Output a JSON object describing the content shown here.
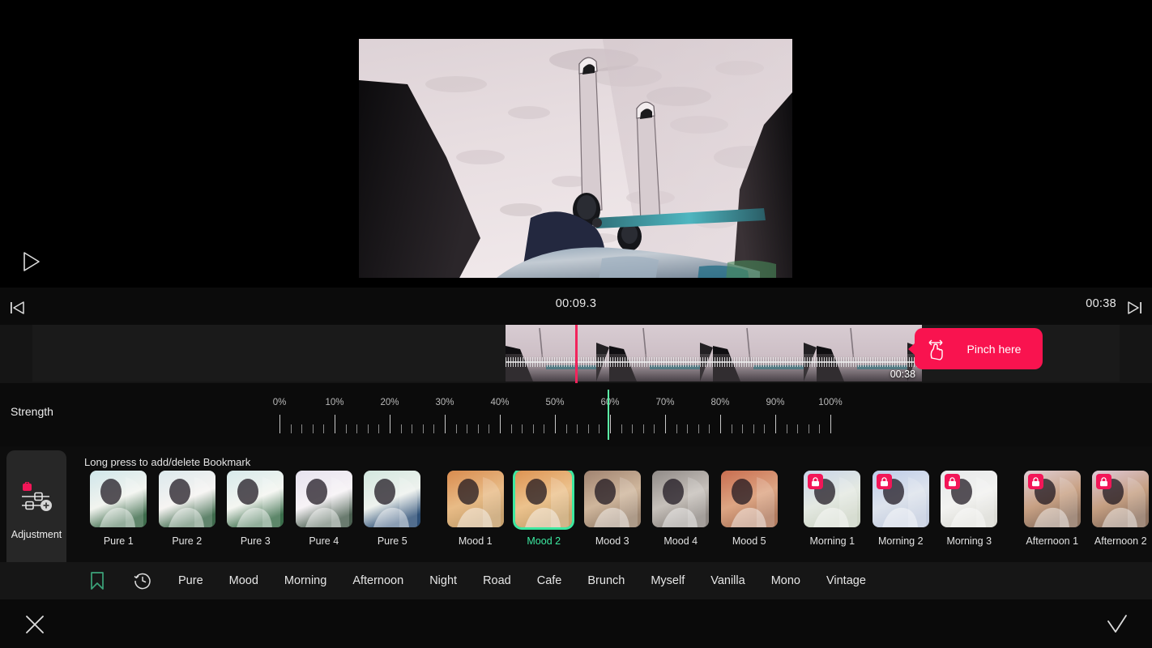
{
  "preview": {
    "play_icon": "play-icon",
    "video_description": "POV skiing down snowy slope"
  },
  "timebar": {
    "current_time": "00:09.3",
    "total_time": "00:38",
    "jump_start_icon": "skip-to-start-icon",
    "jump_end_icon": "skip-to-end-icon",
    "prev_frame_icon": "previous-frame-icon",
    "next_frame_icon": "next-frame-icon"
  },
  "timeline": {
    "clip_duration_label": "00:38",
    "tooltip": {
      "label": "Pinch here",
      "icon": "pinch-gesture-icon",
      "color": "#f9134f"
    },
    "playhead_color": "#f2245c"
  },
  "strength": {
    "label": "Strength",
    "value": 60,
    "unit": "%",
    "ticks": [
      "0%",
      "10%",
      "20%",
      "30%",
      "40%",
      "50%",
      "60%",
      "70%",
      "80%",
      "90%",
      "100%"
    ],
    "indicator_color": "#5bf0a5"
  },
  "adjustment": {
    "label": "Adjustment",
    "icon": "sliders-icon",
    "locked": true,
    "lock_color": "#f31658"
  },
  "filters": {
    "hint": "Long press to add/delete Bookmark",
    "selected": "Mood 2",
    "selected_color": "#3ce8a0",
    "groups": [
      {
        "name": "Pure",
        "items": [
          {
            "label": "Pure 1",
            "locked": false,
            "t1": "#cfe6ea",
            "t2": "#f2f4ef",
            "t3": "#3d6b4b"
          },
          {
            "label": "Pure 2",
            "locked": false,
            "t1": "#dbe8ec",
            "t2": "#f6f4f2",
            "t3": "#3e6a4c"
          },
          {
            "label": "Pure 3",
            "locked": false,
            "t1": "#d6e9ea",
            "t2": "#f4f6f1",
            "t3": "#3a6d4a"
          },
          {
            "label": "Pure 4",
            "locked": false,
            "t1": "#e6e2ee",
            "t2": "#f7f3f6",
            "t3": "#4a5f50"
          },
          {
            "label": "Pure 5",
            "locked": false,
            "t1": "#d2e7de",
            "t2": "#eef2ee",
            "t3": "#2d4f76"
          }
        ]
      },
      {
        "name": "Mood",
        "items": [
          {
            "label": "Mood 1",
            "locked": false,
            "t1": "#d98b4e",
            "t2": "#e8bb86",
            "t3": "#c6a06d"
          },
          {
            "label": "Mood 2",
            "locked": false,
            "t1": "#dd9352",
            "t2": "#ecc28d",
            "t3": "#c9a571"
          },
          {
            "label": "Mood 3",
            "locked": false,
            "t1": "#a08370",
            "t2": "#cfb69c",
            "t3": "#9c8570"
          },
          {
            "label": "Mood 4",
            "locked": false,
            "t1": "#8f8a87",
            "t2": "#c6c0ba",
            "t3": "#908a85"
          },
          {
            "label": "Mood 5",
            "locked": false,
            "t1": "#c96d4f",
            "t2": "#dda583",
            "t3": "#b07a5e"
          }
        ]
      },
      {
        "name": "Morning",
        "items": [
          {
            "label": "Morning 1",
            "locked": true,
            "t1": "#c8d4e8",
            "t2": "#e4e9e2",
            "t3": "#cfd6c8"
          },
          {
            "label": "Morning 2",
            "locked": true,
            "t1": "#bccbe9",
            "t2": "#dde3ec",
            "t3": "#c6cfe0"
          },
          {
            "label": "Morning 3",
            "locked": true,
            "t1": "#e6e8ea",
            "t2": "#f2f2f0",
            "t3": "#dcdcd6"
          }
        ]
      },
      {
        "name": "Afternoon",
        "items": [
          {
            "label": "Afternoon 1",
            "locked": true,
            "t1": "#e0cfd6",
            "t2": "#c8a184",
            "t3": "#8f7462"
          },
          {
            "label": "Afternoon 2",
            "locked": true,
            "t1": "#dfc9d8",
            "t2": "#c59f82",
            "t3": "#8d7260"
          }
        ]
      }
    ]
  },
  "categories": {
    "bookmark_icon": "bookmark-icon",
    "bookmark_color": "#3ca37a",
    "history_icon": "history-clock-icon",
    "tabs": [
      "Pure",
      "Mood",
      "Morning",
      "Afternoon",
      "Night",
      "Road",
      "Cafe",
      "Brunch",
      "Myself",
      "Vanilla",
      "Mono",
      "Vintage"
    ]
  },
  "actions": {
    "cancel_icon": "close-x-icon",
    "confirm_icon": "checkmark-icon"
  }
}
